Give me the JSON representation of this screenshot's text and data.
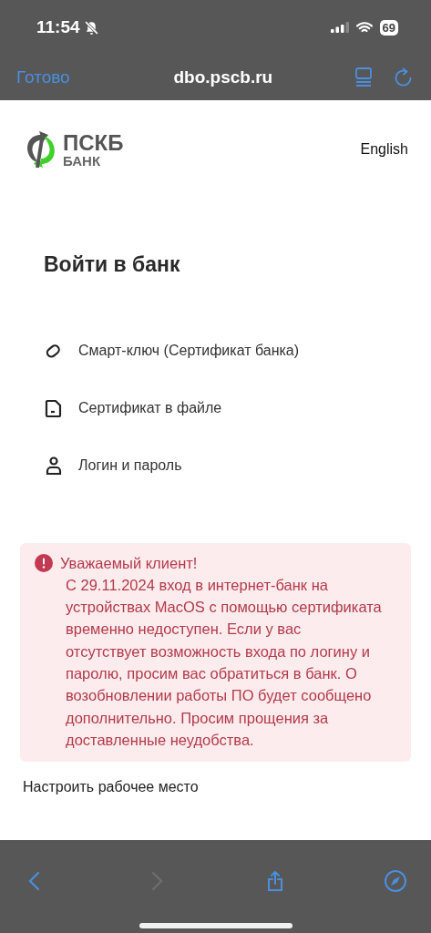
{
  "status_bar": {
    "time": "11:54",
    "battery": "69"
  },
  "browser_bar": {
    "done": "Готово",
    "address": "dbo.pscb.ru"
  },
  "header": {
    "logo_title": "ПСКБ",
    "logo_subtitle": "БАНК",
    "language": "English"
  },
  "title": "Войти в банк",
  "login_methods": [
    {
      "kind": "key",
      "label": "Смарт-ключ (Сертификат банка)"
    },
    {
      "kind": "file",
      "label": "Сертификат в файле"
    },
    {
      "kind": "user",
      "label": "Логин и пароль"
    }
  ],
  "alert": {
    "title": "Уважаемый клиент!",
    "text": "С 29.11.2024 вход в интернет-банк на устройствах MacOS с помощью сертификата временно недоступен. Если у вас отсутствует возможность входа по логину и паролю, просим вас обратиться в банк. О возобновлении работы ПО будет сообщено дополнительно. Просим прощения за доставленные неудобства."
  },
  "setup_link": "Настроить рабочее место",
  "toolbar": [
    {
      "kind": "back",
      "disabled": false
    },
    {
      "kind": "forward",
      "disabled": true
    },
    {
      "kind": "share",
      "disabled": false
    },
    {
      "kind": "compass",
      "disabled": false
    }
  ]
}
